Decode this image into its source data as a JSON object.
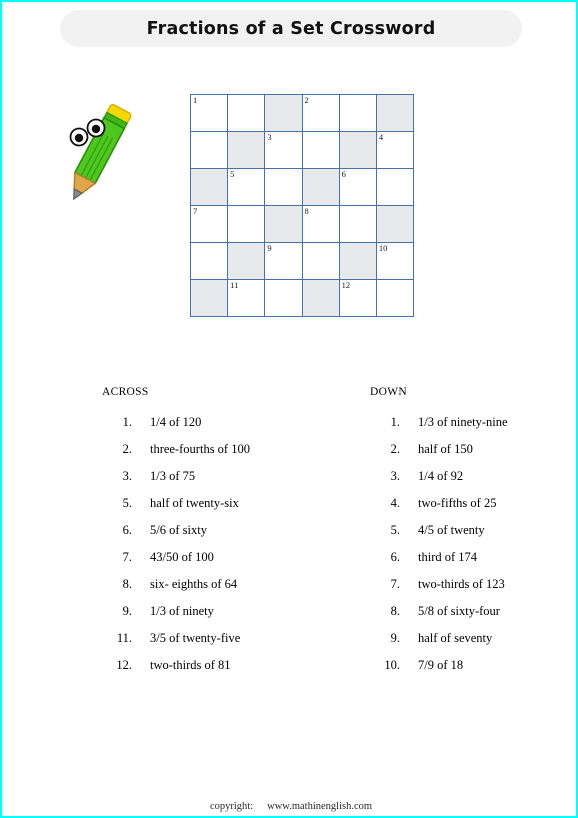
{
  "header": {
    "title": "Fractions of a Set Crossword"
  },
  "mascot": {
    "icon": "pencil-character-icon",
    "body_color": "#4ec81e",
    "eraser_color": "#f5d800",
    "wood_color": "#e0a64b",
    "tip_color": "#8a8a8a"
  },
  "grid": {
    "rows": 6,
    "cols": 6,
    "border_color": "#4472a8",
    "shade_color": "#e8e9eb",
    "cells": [
      [
        {
          "shaded": false,
          "num": "1"
        },
        {
          "shaded": false,
          "num": ""
        },
        {
          "shaded": true,
          "num": ""
        },
        {
          "shaded": false,
          "num": "2"
        },
        {
          "shaded": false,
          "num": ""
        },
        {
          "shaded": true,
          "num": ""
        }
      ],
      [
        {
          "shaded": false,
          "num": ""
        },
        {
          "shaded": true,
          "num": ""
        },
        {
          "shaded": false,
          "num": "3"
        },
        {
          "shaded": false,
          "num": ""
        },
        {
          "shaded": true,
          "num": ""
        },
        {
          "shaded": false,
          "num": "4"
        }
      ],
      [
        {
          "shaded": true,
          "num": ""
        },
        {
          "shaded": false,
          "num": "5"
        },
        {
          "shaded": false,
          "num": ""
        },
        {
          "shaded": true,
          "num": ""
        },
        {
          "shaded": false,
          "num": "6"
        },
        {
          "shaded": false,
          "num": ""
        }
      ],
      [
        {
          "shaded": false,
          "num": "7"
        },
        {
          "shaded": false,
          "num": ""
        },
        {
          "shaded": true,
          "num": ""
        },
        {
          "shaded": false,
          "num": "8"
        },
        {
          "shaded": false,
          "num": ""
        },
        {
          "shaded": true,
          "num": ""
        }
      ],
      [
        {
          "shaded": false,
          "num": ""
        },
        {
          "shaded": true,
          "num": ""
        },
        {
          "shaded": false,
          "num": "9"
        },
        {
          "shaded": false,
          "num": ""
        },
        {
          "shaded": true,
          "num": ""
        },
        {
          "shaded": false,
          "num": "10"
        }
      ],
      [
        {
          "shaded": true,
          "num": ""
        },
        {
          "shaded": false,
          "num": "11"
        },
        {
          "shaded": false,
          "num": ""
        },
        {
          "shaded": true,
          "num": ""
        },
        {
          "shaded": false,
          "num": "12"
        },
        {
          "shaded": false,
          "num": ""
        }
      ]
    ]
  },
  "clues": {
    "across": {
      "heading": "ACROSS",
      "items": [
        {
          "num": "1.",
          "text": "1/4 of 120"
        },
        {
          "num": "2.",
          "text": "three-fourths of 100"
        },
        {
          "num": "3.",
          "text": "1/3 of 75"
        },
        {
          "num": "5.",
          "text": "half of twenty-six"
        },
        {
          "num": "6.",
          "text": "5/6 of sixty"
        },
        {
          "num": "7.",
          "text": "43/50 of 100"
        },
        {
          "num": "8.",
          "text": "six- eighths of 64"
        },
        {
          "num": "9.",
          "text": "1/3 of ninety"
        },
        {
          "num": "11.",
          "text": "3/5 of twenty-five"
        },
        {
          "num": "12.",
          "text": "two-thirds of 81"
        }
      ]
    },
    "down": {
      "heading": "DOWN",
      "items": [
        {
          "num": "1.",
          "text": "1/3 of ninety-nine"
        },
        {
          "num": "2.",
          "text": "half of 150"
        },
        {
          "num": "3.",
          "text": "1/4 of 92"
        },
        {
          "num": "4.",
          "text": "two-fifths of 25"
        },
        {
          "num": "5.",
          "text": "4/5 of twenty"
        },
        {
          "num": "6.",
          "text": "third of 174"
        },
        {
          "num": "7.",
          "text": "two-thirds of 123"
        },
        {
          "num": "8.",
          "text": "5/8 of sixty-four"
        },
        {
          "num": "9.",
          "text": "half of seventy"
        },
        {
          "num": "10.",
          "text": "7/9 of 18"
        }
      ]
    }
  },
  "footer": {
    "copyright_label": "copyright:",
    "website": "www.mathinenglish.com"
  }
}
